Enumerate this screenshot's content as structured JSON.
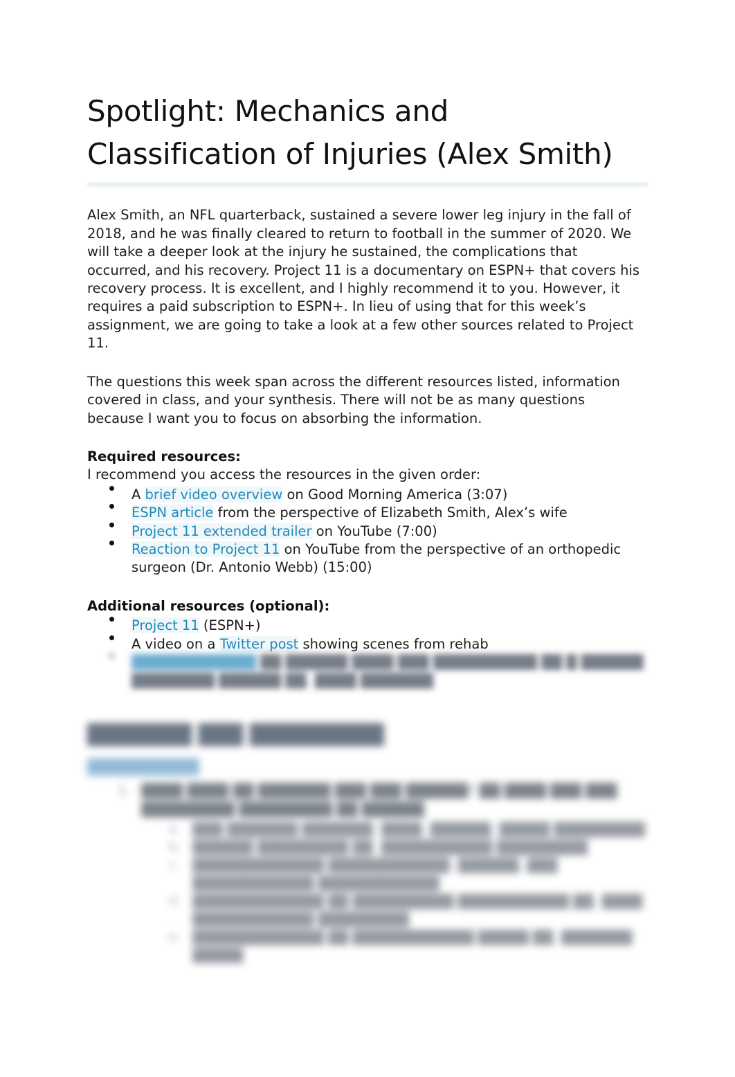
{
  "document": {
    "title": "Spotlight: Mechanics and Classification of Injuries (Alex Smith)",
    "link_color": "#2089b8",
    "heading_color": "#5a6678",
    "subheading_color": "#88b4d2",
    "rule_color": "#dfeaee",
    "paragraphs": {
      "intro": "Alex Smith, an NFL quarterback, sustained a severe lower leg injury in the fall of 2018, and he was finally cleared to return to football in the summer of 2020. We will take a deeper look at the injury he sustained, the complications that occurred, and his recovery. Project 11 is a documentary on ESPN+ that covers his recovery process. It is excellent, and I highly recommend it to you. However, it requires a paid subscription to ESPN+. In lieu of using that for this week’s assignment, we are going to take a look at a few other sources related to Project 11.",
      "questions_note": "The questions this week span across the different resources listed, information covered in class, and your synthesis. There will not be as many questions because I want you to focus on absorbing the information."
    },
    "required_resources": {
      "heading": "Required resources:",
      "lead": "I recommend you access the resources in the given order:",
      "items": [
        {
          "prefix": "A ",
          "link": "brief video overview",
          "suffix": " on Good Morning America (3:07)"
        },
        {
          "prefix": "",
          "link": "ESPN article",
          "suffix": " from the perspective of Elizabeth Smith, Alex’s wife"
        },
        {
          "prefix": "",
          "link": "Project 11 extended trailer",
          "suffix": " on YouTube (7:00)"
        },
        {
          "prefix": "",
          "link": "Reaction to Project 11",
          "suffix": " on YouTube from the perspective of an orthopedic surgeon (Dr. Antonio Webb) (15:00)"
        }
      ]
    },
    "additional_resources": {
      "heading": "Additional resources (optional):",
      "items": [
        {
          "prefix": "",
          "link": "Project 11",
          "suffix": " (ESPN+)"
        },
        {
          "prefix": "A video on a ",
          "link": "Twitter post",
          "suffix": " showing scenes from rehab"
        },
        {
          "prefix": "",
          "link": "████████████",
          "suffix": " ██ ██████ ████ ███ ██████████ ██ █ ██████ ████████ ██████ ██. ████ ███████"
        }
      ]
    },
    "outline": {
      "heading": "███████ ███ █████████",
      "subheading": "██████████",
      "questions": [
        {
          "marker": "1.",
          "text": "████ ████ ██ ███████ ███ ███ ██████? ██ ████ ███ ███ █████████ █████████ ██ ██████.",
          "subitems": [
            {
              "marker": "a.",
              "text": "███ ███████ ███████: ████, ██████, █████ █████████"
            },
            {
              "marker": "b.",
              "text": "██████ █████████ ██. ███████████ █████████"
            },
            {
              "marker": "c.",
              "text": "█████████████ ████████████: ██████, ███ ████████████ ████████████"
            },
            {
              "marker": "d.",
              "text": "█████████████ ██ ██████████ ███████████ ██. ████ ████████████ █████████"
            },
            {
              "marker": "e.",
              "text": "█████████████ ██ ████████████ █████ ██. ███████ █████"
            }
          ]
        }
      ]
    }
  }
}
